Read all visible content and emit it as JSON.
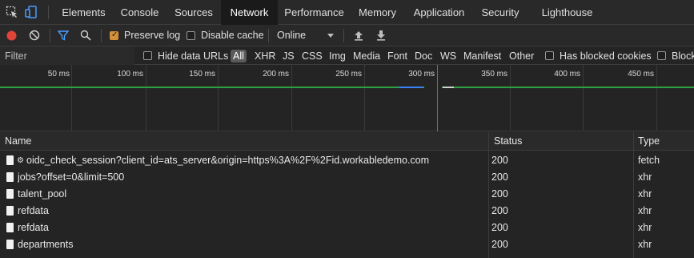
{
  "tabs": [
    {
      "label": "Elements"
    },
    {
      "label": "Console"
    },
    {
      "label": "Sources"
    },
    {
      "label": "Network"
    },
    {
      "label": "Performance"
    },
    {
      "label": "Memory"
    },
    {
      "label": "Application"
    },
    {
      "label": "Security"
    },
    {
      "label": "Lighthouse"
    }
  ],
  "active_tab": "Network",
  "toolbar": {
    "preserve_log_label": "Preserve log",
    "preserve_log_checked": true,
    "disable_cache_label": "Disable cache",
    "disable_cache_checked": false,
    "throttling_value": "Online"
  },
  "filter": {
    "placeholder": "Filter",
    "hide_data_urls_label": "Hide data URLs",
    "types": [
      "All",
      "XHR",
      "JS",
      "CSS",
      "Img",
      "Media",
      "Font",
      "Doc",
      "WS",
      "Manifest",
      "Other"
    ],
    "selected_type": "All",
    "has_blocked_cookies_label": "Has blocked cookies",
    "blocked_requests_label": "Block"
  },
  "overview": {
    "ticks": [
      "50 ms",
      "100 ms",
      "150 ms",
      "200 ms",
      "250 ms",
      "300 ms",
      "350 ms",
      "400 ms",
      "450 ms"
    ],
    "line_color": "#2ea043",
    "accent_color": "#3b82f6"
  },
  "table": {
    "columns": {
      "name": "Name",
      "status": "Status",
      "type": "Type"
    },
    "rows": [
      {
        "name": "oidc_check_session?client_id=ats_server&origin=https%3A%2F%2Fid.workabledemo.com",
        "status": "200",
        "type": "fetch",
        "gear": "⚙"
      },
      {
        "name": "jobs?offset=0&limit=500",
        "status": "200",
        "type": "xhr"
      },
      {
        "name": "talent_pool",
        "status": "200",
        "type": "xhr"
      },
      {
        "name": "refdata",
        "status": "200",
        "type": "xhr"
      },
      {
        "name": "refdata",
        "status": "200",
        "type": "xhr"
      },
      {
        "name": "departments",
        "status": "200",
        "type": "xhr"
      }
    ]
  },
  "colors": {
    "record": "#e0453a",
    "preserve_checkbox": "#d38f3a",
    "filter_icon": "#4a9eff"
  }
}
